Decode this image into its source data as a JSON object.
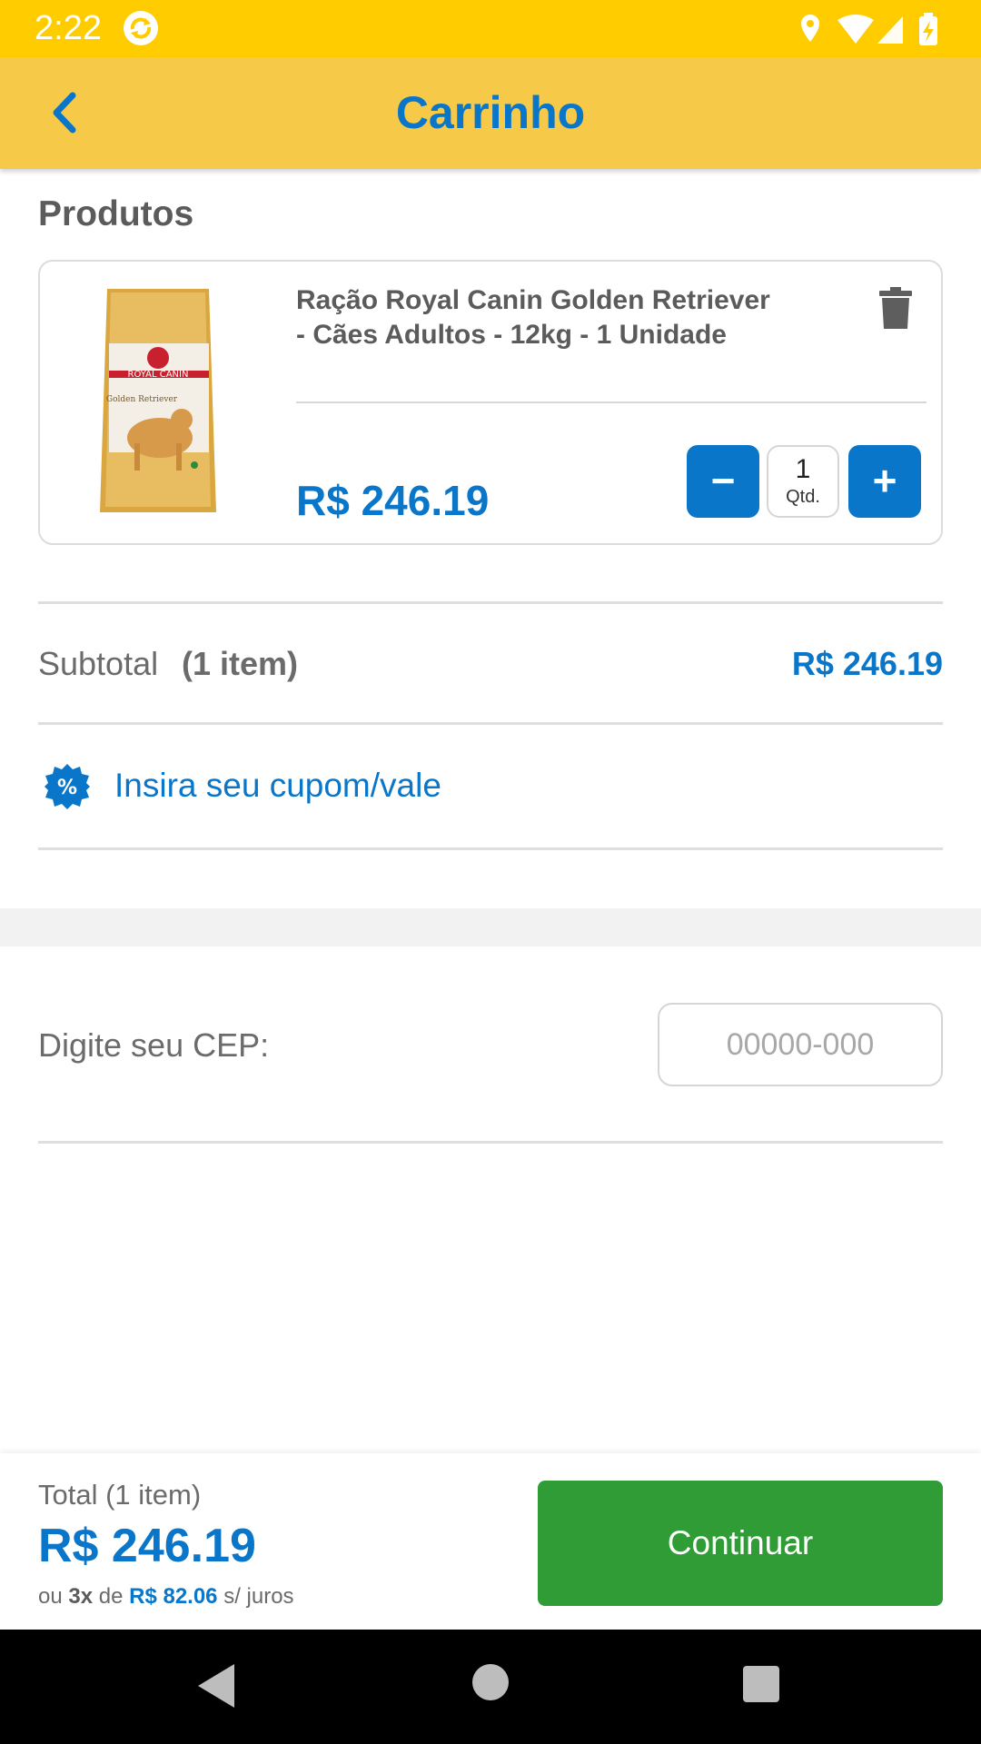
{
  "status_bar": {
    "time": "2:22"
  },
  "app_bar": {
    "title": "Carrinho"
  },
  "products_section": {
    "title": "Produtos"
  },
  "product": {
    "name": "Ração Royal Canin Golden Retriever - Cães Adultos - 12kg - 1 Unidade",
    "price": "R$ 246.19",
    "quantity": "1",
    "quantity_label": "Qtd.",
    "minus_label": "−",
    "plus_label": "+",
    "image_brand": "ROYAL CANIN",
    "image_text": "Golden Retriever"
  },
  "subtotal": {
    "label": "Subtotal",
    "count": "(1 item)",
    "value": "R$ 246.19"
  },
  "coupon": {
    "label": "Insira seu cupom/vale",
    "icon_glyph": "%"
  },
  "cep": {
    "label": "Digite seu CEP:",
    "placeholder": "00000-000",
    "value": ""
  },
  "footer": {
    "total_label": "Total (1 item)",
    "total_value": "R$ 246.19",
    "installment_prefix": "ou",
    "installment_count": "3x",
    "installment_of": "de",
    "installment_value": "R$ 82.06",
    "installment_suffix": "s/ juros",
    "continue_label": "Continuar"
  },
  "colors": {
    "status_bar": "#ffcc00",
    "app_bar": "#f7c948",
    "accent_blue": "#0a76c9",
    "continue_green": "#2f9c35"
  },
  "icons": {
    "back": "chevron-left-icon",
    "delete": "trash-icon",
    "coupon": "percent-badge-icon",
    "status_location": "location-icon",
    "status_wifi": "wifi-icon",
    "status_signal": "signal-icon",
    "status_battery": "battery-charging-icon"
  }
}
